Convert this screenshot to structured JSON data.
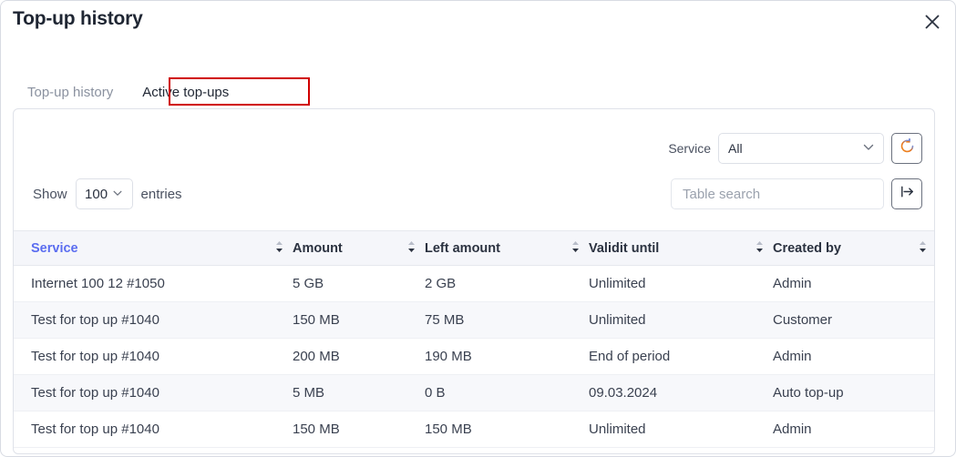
{
  "dialog": {
    "title": "Top-up history",
    "close_icon": "close-icon"
  },
  "tabs": [
    {
      "label": "Top-up history",
      "active": false
    },
    {
      "label": "Active top-ups",
      "active": true
    }
  ],
  "toolbar": {
    "service_filter_label": "Service",
    "service_filter_value": "All",
    "service_filter_options": [
      "All"
    ],
    "refresh_icon": "refresh-icon",
    "show_label": "Show",
    "entries_value": "100",
    "entries_options": [
      "100"
    ],
    "entries_label": "entries",
    "search_placeholder": "Table search",
    "search_value": "",
    "search_submit_icon": "arrow-right-bar-icon"
  },
  "table": {
    "columns": [
      {
        "label": "Service",
        "sorted": true
      },
      {
        "label": "Amount",
        "sorted": false
      },
      {
        "label": "Left amount",
        "sorted": false
      },
      {
        "label": "Validit until",
        "sorted": false
      },
      {
        "label": "Created by",
        "sorted": false
      }
    ],
    "rows": [
      {
        "service": "Internet 100 12 #1050",
        "amount": "5 GB",
        "left": "2 GB",
        "valid": "Unlimited",
        "created": "Admin"
      },
      {
        "service": "Test for top up #1040",
        "amount": "150 MB",
        "left": "75 MB",
        "valid": "Unlimited",
        "created": "Customer"
      },
      {
        "service": "Test for top up #1040",
        "amount": "200 MB",
        "left": "190 MB",
        "valid": "End of period",
        "created": "Admin"
      },
      {
        "service": "Test for top up #1040",
        "amount": "5 MB",
        "left": "0 B",
        "valid": "09.03.2024",
        "created": "Auto top-up"
      },
      {
        "service": "Test for top up #1040",
        "amount": "150 MB",
        "left": "150 MB",
        "valid": "Unlimited",
        "created": "Admin"
      }
    ]
  },
  "colors": {
    "accent": "#5b6df0",
    "highlight": "#d00000",
    "header_bg": "#f5f6fa",
    "stripe": "#f7f8fb"
  }
}
